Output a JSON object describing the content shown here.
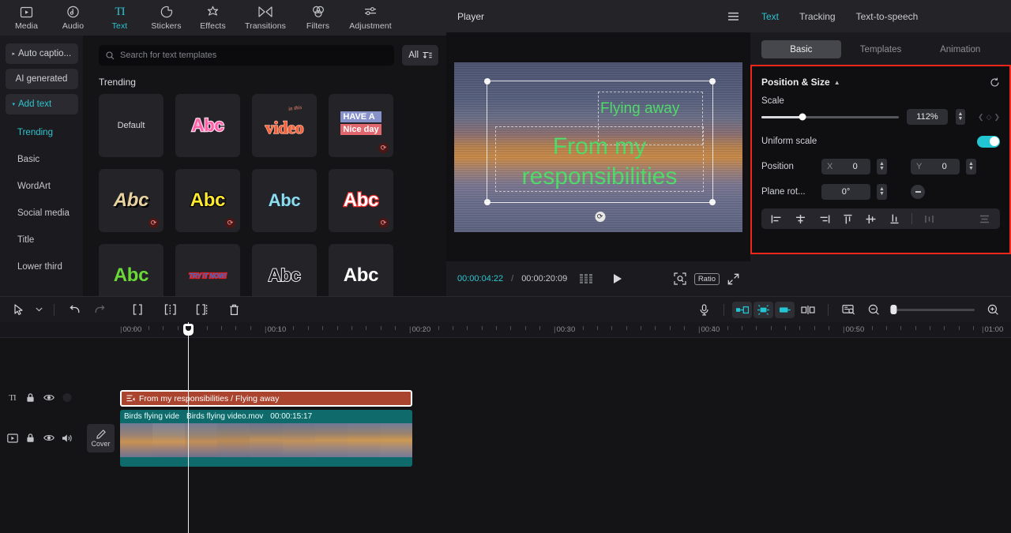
{
  "topbar": {
    "items": [
      {
        "label": "Media",
        "icon": "media-icon",
        "active": false
      },
      {
        "label": "Audio",
        "icon": "audio-icon",
        "active": false
      },
      {
        "label": "Text",
        "icon": "text-icon",
        "active": true
      },
      {
        "label": "Stickers",
        "icon": "stickers-icon",
        "active": false
      },
      {
        "label": "Effects",
        "icon": "effects-icon",
        "active": false
      },
      {
        "label": "Transitions",
        "icon": "transitions-icon",
        "active": false
      },
      {
        "label": "Filters",
        "icon": "filters-icon",
        "active": false
      },
      {
        "label": "Adjustment",
        "icon": "adjustment-icon",
        "active": false
      }
    ]
  },
  "leftnav": {
    "buttons": [
      {
        "label": "Auto captio...",
        "caret": "▸",
        "teal": false
      },
      {
        "label": "AI generated",
        "caret": "",
        "teal": false
      },
      {
        "label": "Add text",
        "caret": "▾",
        "teal": true
      }
    ],
    "subitems": [
      {
        "label": "Trending",
        "selected": true
      },
      {
        "label": "Basic",
        "selected": false
      },
      {
        "label": "WordArt",
        "selected": false
      },
      {
        "label": "Social media",
        "selected": false
      },
      {
        "label": "Title",
        "selected": false
      },
      {
        "label": "Lower third",
        "selected": false
      }
    ]
  },
  "templates": {
    "search_placeholder": "Search for text templates",
    "filter_label": "All",
    "section_title": "Trending",
    "cells": [
      {
        "name": "default",
        "text": "Default",
        "style": "plain",
        "download": false
      },
      {
        "name": "abc-pink",
        "text": "Abc",
        "style": "pink",
        "download": false
      },
      {
        "name": "video-orange",
        "text": "video",
        "style": "video",
        "download": false
      },
      {
        "name": "have-a-nice-day",
        "text": "HAVE A",
        "text2": "Nice day",
        "style": "twoline",
        "download": true
      },
      {
        "name": "abc-gold-italic",
        "text": "Abc",
        "style": "gold",
        "download": true
      },
      {
        "name": "abc-yellow",
        "text": "Abc",
        "style": "yellow",
        "download": true
      },
      {
        "name": "abc-cyan",
        "text": "Abc",
        "style": "cyan",
        "download": false
      },
      {
        "name": "abc-red",
        "text": "Abc",
        "style": "red",
        "download": true
      },
      {
        "name": "abc-green",
        "text": "Abc",
        "style": "green",
        "download": false
      },
      {
        "name": "try-it-now",
        "text": "TRY IT NOW!",
        "style": "tryit",
        "download": false
      },
      {
        "name": "abc-outline",
        "text": "Abc",
        "style": "outline",
        "download": false
      },
      {
        "name": "abc-white",
        "text": "Abc",
        "style": "white",
        "download": false
      }
    ]
  },
  "player": {
    "title": "Player",
    "current_time": "00:00:04:22",
    "separator": "/",
    "total_time": "00:00:20:09",
    "ratio_label": "Ratio",
    "overlay_text_1": "Flying away",
    "overlay_text_2": "From my responsibilities",
    "overlay_color": "#4ee06a"
  },
  "rightpanel": {
    "tabs": [
      {
        "label": "Text",
        "active": true
      },
      {
        "label": "Tracking",
        "active": false
      },
      {
        "label": "Text-to-speech",
        "active": false
      }
    ],
    "segments": [
      {
        "label": "Basic",
        "active": true
      },
      {
        "label": "Templates",
        "active": false
      },
      {
        "label": "Animation",
        "active": false
      }
    ],
    "position_size": {
      "title": "Position & Size",
      "scale_label": "Scale",
      "scale_value": "112%",
      "uniform_scale_label": "Uniform scale",
      "uniform_scale_on": true,
      "position_label": "Position",
      "position_x_label": "X",
      "position_x_value": "0",
      "position_y_label": "Y",
      "position_y_value": "0",
      "rotation_label": "Plane rot...",
      "rotation_value": "0°",
      "highlight_color": "#f0261a",
      "accent_color": "#22c6d2"
    }
  },
  "timeline": {
    "ruler_ticks": [
      "00:00",
      "00:10",
      "00:20",
      "00:30",
      "00:40",
      "00:50",
      "01:00"
    ],
    "text_clip": {
      "label": "From my responsibilities / Flying away",
      "color": "#ab442f"
    },
    "video_clip": {
      "label_left": "Birds flying vide",
      "label_name": "Birds flying video.mov",
      "duration": "00:00:15:17",
      "color": "#0f6b6b"
    },
    "cover_label": "Cover"
  }
}
